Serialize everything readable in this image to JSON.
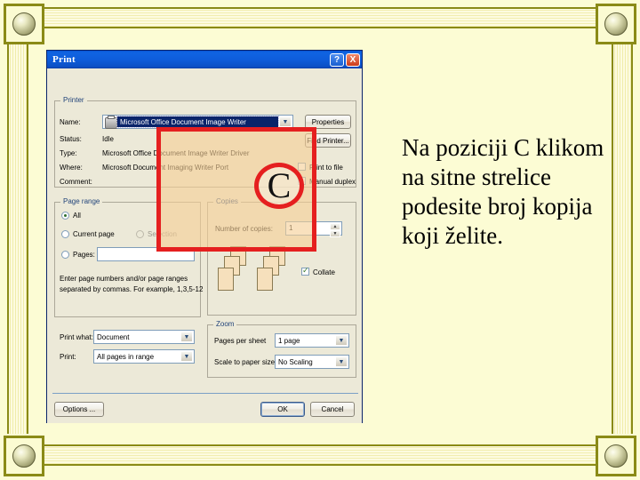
{
  "slide": {
    "body_text": "Na poziciji C klikom na sitne strelice podesite broj kopija koji želite.",
    "marker_letter": "C",
    "accent_red": "#e51f1f",
    "frame_olive": "#8a8a16",
    "background": "#fcfcd4"
  },
  "dialog": {
    "title": "Print",
    "titlebar": {
      "help_label": "?",
      "close_label": "X"
    },
    "printer": {
      "group_label": "Printer",
      "name_label": "Name:",
      "name_value": "Microsoft Office Document Image Writer",
      "status_label": "Status:",
      "status_value": "Idle",
      "type_label": "Type:",
      "type_value": "Microsoft Office Document Image Writer Driver",
      "where_label": "Where:",
      "where_value": "Microsoft Document Imaging Writer Port",
      "comment_label": "Comment:",
      "comment_value": "",
      "properties_button": "Properties",
      "find_printer_button": "Find Printer...",
      "print_to_file_label": "Print to file",
      "manual_duplex_label": "Manual duplex"
    },
    "page_range": {
      "group_label": "Page range",
      "all_label": "All",
      "current_page_label": "Current page",
      "selection_label": "Selection",
      "pages_label": "Pages:",
      "pages_value": "",
      "hint_line1": "Enter page numbers and/or page ranges",
      "hint_line2": "separated by commas. For example, 1,3,5-12"
    },
    "copies": {
      "group_label": "Copies",
      "number_label": "Number of copies:",
      "number_value": "1",
      "spin_up": "▲",
      "spin_down": "▼",
      "collate_label": "Collate",
      "collate_checked": true
    },
    "print_what": {
      "label": "Print what:",
      "value": "Document"
    },
    "print_range": {
      "label": "Print:",
      "value": "All pages in range"
    },
    "zoom": {
      "group_label": "Zoom",
      "pages_per_sheet_label": "Pages per sheet",
      "pages_per_sheet_value": "1 page",
      "scale_label": "Scale to paper size",
      "scale_value": "No Scaling"
    },
    "buttons": {
      "options": "Options ...",
      "ok": "OK",
      "cancel": "Cancel"
    }
  }
}
